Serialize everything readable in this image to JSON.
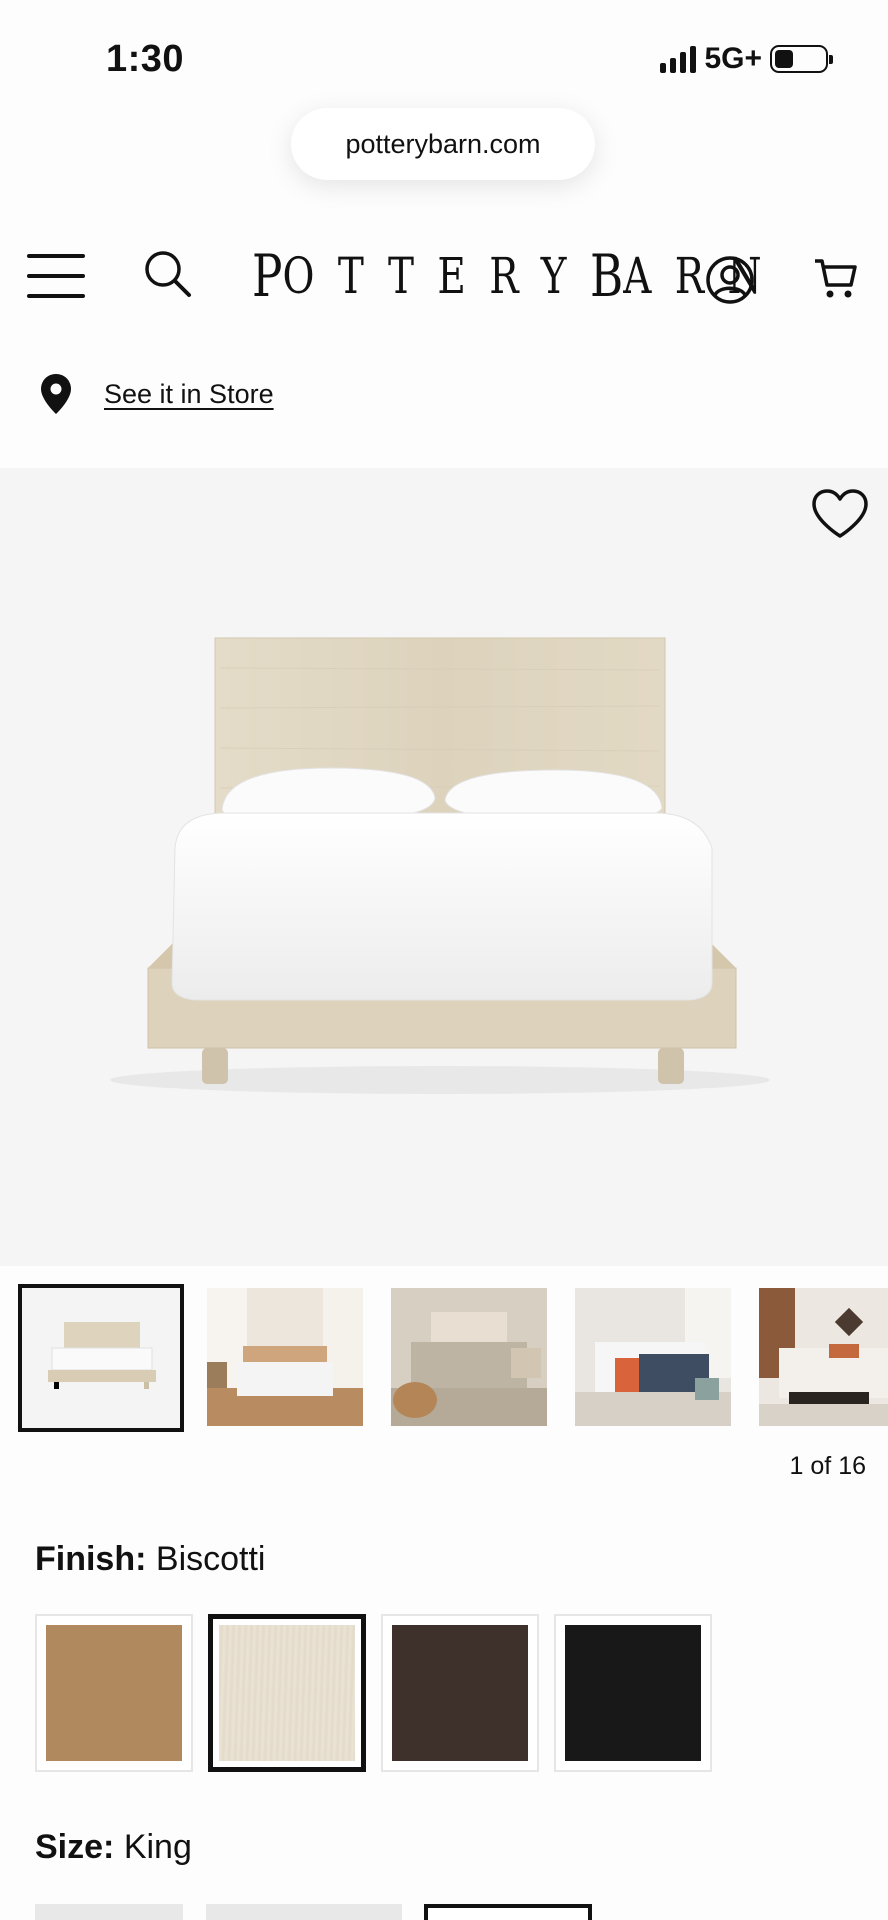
{
  "status_bar": {
    "time": "1:30",
    "network": "5G+"
  },
  "browser": {
    "url": "potterybarn.com"
  },
  "header": {
    "brand_small_1": "OTTERY",
    "brand_big_1": "P",
    "brand_big_2": "B",
    "brand_small_2": "ARN"
  },
  "store": {
    "link_label": "See it in Store"
  },
  "gallery": {
    "counter": "1 of 16",
    "thumbnail_count": 5
  },
  "finish": {
    "label": "Finish:",
    "value": "Biscotti",
    "swatches": [
      {
        "color": "#b08a5e"
      },
      {
        "color": "#e6ddcc",
        "selected": true
      },
      {
        "color": "#3e302b"
      },
      {
        "color": "#181818"
      }
    ]
  },
  "size": {
    "label": "Size:",
    "value": "King"
  },
  "colors": {
    "hero_bg": "#f5f5f5",
    "accent": "#111111"
  }
}
